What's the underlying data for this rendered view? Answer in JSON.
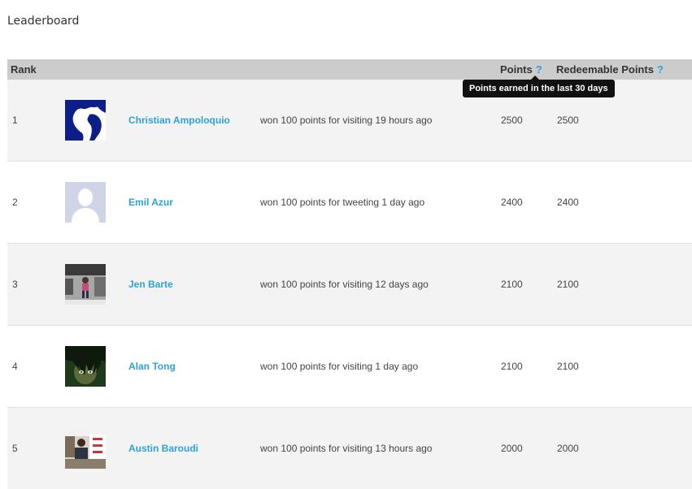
{
  "page": {
    "title": "Leaderboard"
  },
  "table": {
    "headers": {
      "rank": "Rank",
      "points": "Points",
      "redeemable_points": "Redeemable Points",
      "help_mark": "?"
    },
    "tooltip": "Points earned in the last 30 days",
    "rows": [
      {
        "rank": "1",
        "name": "Christian Ampoloquio",
        "activity": "won 100 points for visiting 19 hours ago",
        "points": "2500",
        "redeemable": "2500",
        "avatar": "avatar-christian"
      },
      {
        "rank": "2",
        "name": "Emil Azur",
        "activity": "won 100 points for tweeting 1 day ago",
        "points": "2400",
        "redeemable": "2400",
        "avatar": "avatar-default-silhouette"
      },
      {
        "rank": "3",
        "name": "Jen Barte",
        "activity": "won 100 points for visiting 12 days ago",
        "points": "2100",
        "redeemable": "2100",
        "avatar": "avatar-jen"
      },
      {
        "rank": "4",
        "name": "Alan Tong",
        "activity": "won 100 points for visiting 1 day ago",
        "points": "2100",
        "redeemable": "2100",
        "avatar": "avatar-alan"
      },
      {
        "rank": "5",
        "name": "Austin Baroudi",
        "activity": "won 100 points for visiting 13 hours ago",
        "points": "2000",
        "redeemable": "2000",
        "avatar": "avatar-austin"
      }
    ]
  },
  "colors": {
    "link": "#2aa3d8",
    "header_bg": "#cccccc",
    "row_alt_bg": "#f3f3f3",
    "tooltip_bg": "#111111"
  }
}
